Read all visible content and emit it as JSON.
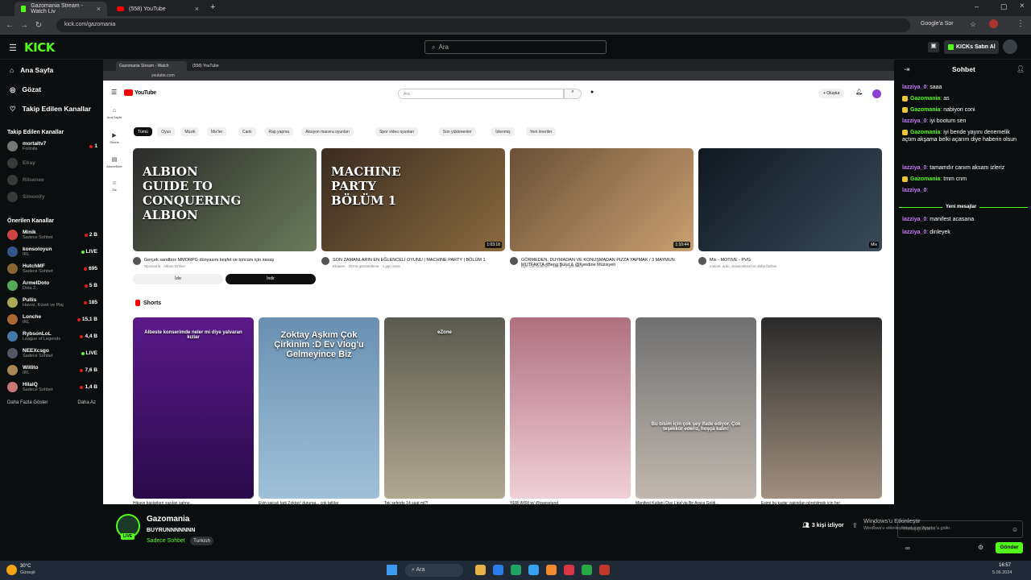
{
  "browser": {
    "tabs": [
      {
        "label": "Gazomania Stream - Watch Liv",
        "icon": "kick-icon",
        "active": true
      },
      {
        "label": "(558) YouTube",
        "icon": "youtube-icon",
        "active": false
      }
    ],
    "url": "kick.com/gazomania",
    "google_lens_label": "Google'a Sor"
  },
  "kick": {
    "logo": "KICK",
    "search_placeholder": "Ara",
    "buy_kicks": "KICKs Satın Al",
    "nav": [
      {
        "label": "Ana Sayfa",
        "icon": "home-icon"
      },
      {
        "label": "Gözat",
        "icon": "compass-icon"
      },
      {
        "label": "Takip Edilen Kanallar",
        "icon": "heart-icon"
      }
    ],
    "followed_header": "Takip Edilen Kanallar",
    "followed": [
      {
        "name": "mortaltv7",
        "category": "Fortnite",
        "count": "1",
        "color": "#777",
        "offline": false
      },
      {
        "name": "Elray",
        "category": "",
        "count": "",
        "color": "#666",
        "offline": true
      },
      {
        "name": "Rilsenee",
        "category": "",
        "count": "",
        "color": "#666",
        "offline": true
      },
      {
        "name": "Simonify",
        "category": "",
        "count": "",
        "color": "#666",
        "offline": true
      }
    ],
    "recommended_header": "Önerilen Kanallar",
    "recommended": [
      {
        "name": "Minik",
        "category": "Sadece Sohbet",
        "count": "2 B",
        "color": "#c44"
      },
      {
        "name": "konsoloyun",
        "category": "IRL",
        "count": "LIVE",
        "color": "#358"
      },
      {
        "name": "HutchMF",
        "category": "Sadece Sohbet",
        "count": "695",
        "color": "#863"
      },
      {
        "name": "ArmelDoto",
        "category": "Dota 2",
        "count": "5 B",
        "color": "#5a5"
      },
      {
        "name": "Pullis",
        "category": "Havuz, Küvet ve Plaj",
        "count": "185",
        "color": "#aa5"
      },
      {
        "name": "Lonche",
        "category": "IRL",
        "count": "15,1 B",
        "color": "#a63"
      },
      {
        "name": "RybsonLoL",
        "category": "League of Legends",
        "count": "4,4 B",
        "color": "#47a"
      },
      {
        "name": "NEEXcsgo",
        "category": "Sadece Sohbet",
        "count": "LIVE",
        "color": "#556"
      },
      {
        "name": "Willito",
        "category": "IRL",
        "count": "7,6 B",
        "color": "#a85"
      },
      {
        "name": "HilalQ",
        "category": "Sadece Sohbet",
        "count": "1,4 B",
        "color": "#c77"
      }
    ],
    "show_more": "Daha Fazla Göster",
    "show_less": "Daha Az"
  },
  "stream": {
    "inner_tabs": [
      "Gazomania Stream - Watch",
      "(558) YouTube"
    ],
    "inner_url": "youtube.com",
    "yt_search_placeholder": "Ara",
    "yt_create": "+ Oluştur",
    "yt_logo": "YouTube",
    "yt_side": [
      "Ana Sayfa",
      "Shorts",
      "Abonelikler",
      "Siz"
    ],
    "chips": [
      {
        "label": "Tümü",
        "on": true
      },
      {
        "label": "Oyun",
        "on": false
      },
      {
        "label": "Müzik",
        "on": false
      },
      {
        "label": "Mix'ler",
        "on": false
      },
      {
        "label": "Canlı",
        "on": false
      },
      {
        "label": "Rap yapma",
        "on": false
      },
      {
        "label": "Aksiyon macera oyunları",
        "on": false
      },
      {
        "label": "Spor video oyunları",
        "on": false
      },
      {
        "label": "Son yüklenenler",
        "on": false
      },
      {
        "label": "İzlenmiş",
        "on": false
      },
      {
        "label": "Yeni öneriler",
        "on": false
      }
    ],
    "videos": [
      {
        "title": "Gerçek sandbox MMORPG dünyasını keşfet ve toncanı için savaş",
        "meta": "Sponsorlu · Albion Online",
        "duration": "",
        "thumb_text": "ALBION GUIDE TO CONQUERING ALBION",
        "bg1": "#2b2b2b",
        "bg2": "#6a7b5a"
      },
      {
        "title": "SON ZAMANLARIN EN EĞLENCELİ OYUNU | MACHINE PARTY | BÖLÜM 1",
        "meta": "Elraenn · 204 B görüntüleme · 3 gün önce",
        "duration": "1:03:18",
        "thumb_text": "MACHINE PARTY BÖLÜM 1",
        "bg1": "#3a2c20",
        "bg2": "#8a6a40"
      },
      {
        "title": "GÖRMEDEN, DUYMADAN VE KONUŞMADAN PIZZA YAPMAK / 3 MAYMUN MUTFAKTA #Beng Bulut & @Kendine Müzisyen",
        "meta": "Ege Can Ödemer · 350 B · 1 gün önce",
        "duration": "1:10:44",
        "thumb_text": "",
        "bg1": "#6a5038",
        "bg2": "#c8a070"
      },
      {
        "title": "Mix - MOTIVE - PVG",
        "meta": "motive, ardo, Sessionlend ve daha fazlası",
        "duration": "Mix",
        "thumb_text": "",
        "bg1": "#101820",
        "bg2": "#3a4a58"
      }
    ],
    "ad_buttons": [
      "İzle",
      "İndir"
    ],
    "shorts_label": "Shorts",
    "shorts": [
      {
        "title": "Hikaye başlarken yazılan sahne...",
        "overlay": "Albeste konserimde neler mi diye yalvaran kızlar",
        "bg1": "#5a1a8a",
        "bg2": "#2a0a4a"
      },
      {
        "title": "Evin salçalı tadı Zoktay! durursa... çok tatlılar",
        "overlay": "Zoktay Aşkım Çok Çirkinim :D Ev Vlog'u Gelmeyince Biz",
        "bg1": "#6a90b0",
        "bg2": "#a0c0d8"
      },
      {
        "title": "Tek seferde 14 saat mi?!",
        "overlay": "eZone",
        "bg1": "#5a5a50",
        "bg2": "#b0a890"
      },
      {
        "title": "YERİ AYRI w/ @gueselund",
        "overlay": "",
        "bg1": "#b07080",
        "bg2": "#f0d0d8"
      },
      {
        "title": "Manifest Kutlanı Duo Lipa'yla Bir Araya Geldi...",
        "overlay": "Bu bisim için çok şey ifade ediyor. Çok teşekkür ederiz, hoşça kalın!",
        "bg1": "#707070",
        "bg2": "#c0b8b0"
      },
      {
        "title": "Eşimi bu kadar yakından görebilmek için her",
        "overlay": "",
        "bg1": "#2a2a2a",
        "bg2": "#a09080"
      }
    ]
  },
  "chat": {
    "title": "Sohbet",
    "messages": [
      {
        "user": "lazziya_0",
        "text": "saaa",
        "color": "#c77dff",
        "badge": false
      },
      {
        "user": "Gazomania",
        "text": "as",
        "color": "#53fc18",
        "badge": true
      },
      {
        "user": "Gazomania",
        "text": "nabiyon coni",
        "color": "#53fc18",
        "badge": true
      },
      {
        "user": "lazziya_0",
        "text": "iyi bootum sen",
        "color": "#c77dff",
        "badge": false
      },
      {
        "user": "Gazomania",
        "text": "iyi bende yayını denemelik açtım akşama belki açarım diye haberin olsun",
        "color": "#53fc18",
        "badge": true
      },
      {
        "user": "lazziya_0",
        "text": "tamamdır canım aksam izleriz",
        "color": "#c77dff",
        "badge": false
      },
      {
        "user": "Gazomania",
        "text": "tmm cnm",
        "color": "#53fc18",
        "badge": true
      },
      {
        "user": "lazziya_0",
        "text": "",
        "color": "#c77dff",
        "badge": false
      },
      {
        "user": "lazziya_0",
        "text": "manifest acasana",
        "color": "#c77dff",
        "badge": false
      },
      {
        "user": "lazziya_0",
        "text": "dinleyek",
        "color": "#c77dff",
        "badge": false
      }
    ],
    "new_messages": "Yeni mesajlar",
    "send_label": "Gönder",
    "input_placeholder": "Mesaj gönder..."
  },
  "channel": {
    "name": "Gazomania",
    "stream_title": "BUYRUNNNNNNN",
    "category": "Sadece Sohbet",
    "tag": "Turkish",
    "live_label": "LIVE",
    "viewers": "3 kişi izliyor"
  },
  "windows": {
    "search_label": "Ara",
    "weather_temp": "30°C",
    "weather_desc": "Güneşli",
    "time": "16:57",
    "date": "5.06.2024",
    "activate_line1": "Windows'u Etkinleştir",
    "activate_line2": "Windows'u etkinleştirmek için Ayarlar'a gidin."
  },
  "colors": {
    "kick_green": "#53fc18",
    "youtube_red": "#ff0000",
    "kick_bg": "#0b0e0f"
  }
}
